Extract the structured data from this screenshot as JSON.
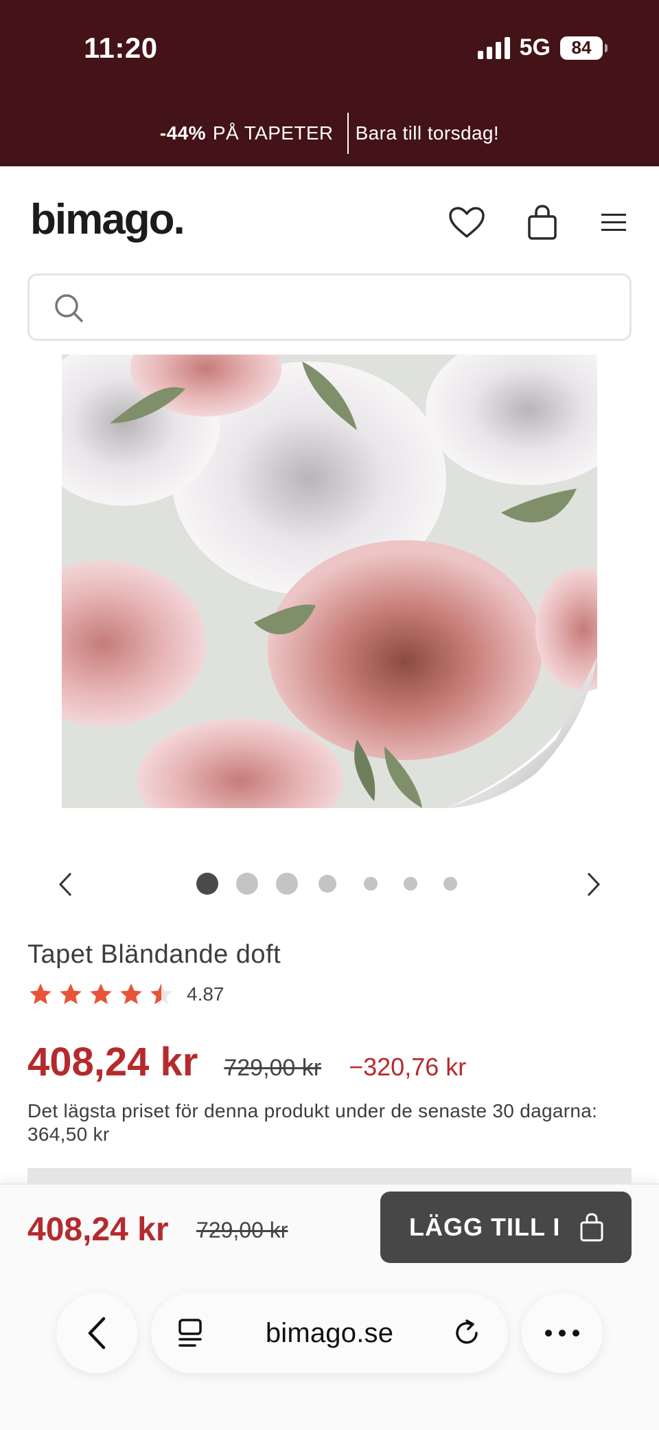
{
  "status_bar": {
    "time": "11:20",
    "network": "5G",
    "battery": "84"
  },
  "promo": {
    "discount": "-44%",
    "text": "PÅ TAPETER",
    "deadline": "Bara till torsdag!"
  },
  "header": {
    "logo": "bimago."
  },
  "search": {
    "placeholder": ""
  },
  "gallery": {
    "image_count": 7,
    "active_index": 0
  },
  "product": {
    "title": "Tapet Bländande doft",
    "rating": 4.87,
    "rating_text": "4.87",
    "price": "408,24 kr",
    "old_price": "729,00 kr",
    "saving": "−320,76 kr",
    "lowest_price_note": "Det lägsta priset för denna produkt under de senaste 30 dagarna: 364,50 kr"
  },
  "buy_bar": {
    "price": "408,24 kr",
    "old_price": "729,00 kr",
    "add_label": "LÄGG TILL I"
  },
  "browser": {
    "url": "bimago.se"
  },
  "colors": {
    "banner": "#431317",
    "price": "#b52a2c",
    "star": "#e8543a",
    "button": "#474747"
  }
}
